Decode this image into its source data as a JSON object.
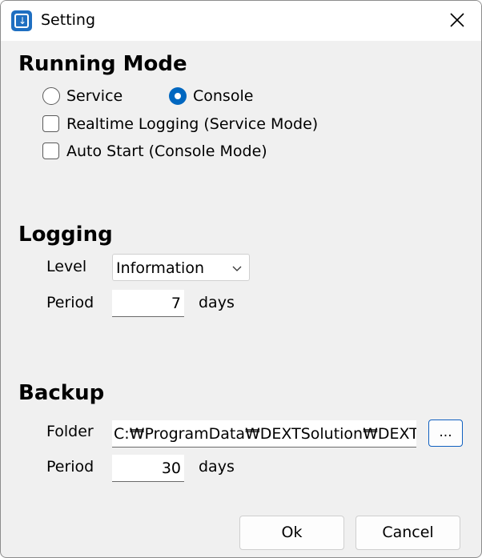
{
  "window": {
    "title": "Setting"
  },
  "running_mode": {
    "heading": "Running Mode",
    "radio_service": "Service",
    "radio_console": "Console",
    "selected": "Console",
    "realtime_logging": "Realtime Logging (Service Mode)",
    "realtime_logging_checked": false,
    "auto_start": "Auto Start (Console Mode)",
    "auto_start_checked": false
  },
  "logging": {
    "heading": "Logging",
    "level_label": "Level",
    "level_value": "Information",
    "period_label": "Period",
    "period_value": "7",
    "period_unit": "days"
  },
  "backup": {
    "heading": "Backup",
    "folder_label": "Folder",
    "folder_value": "C:₩ProgramData₩DEXTSolution₩DEXTM",
    "browse_label": "...",
    "period_label": "Period",
    "period_value": "30",
    "period_unit": "days"
  },
  "buttons": {
    "ok": "Ok",
    "cancel": "Cancel"
  },
  "colors": {
    "accent": "#0067c0",
    "background": "#f0f0f0"
  }
}
